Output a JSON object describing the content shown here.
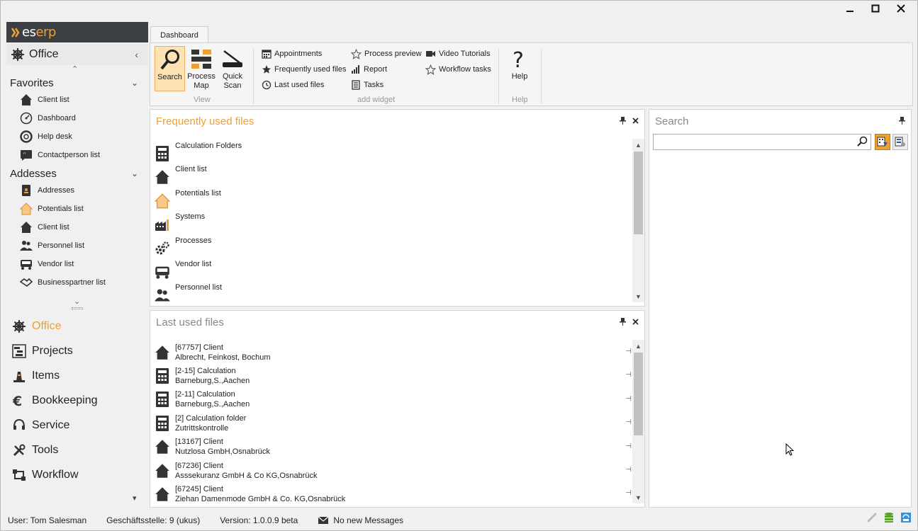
{
  "window": {
    "minimize": "—",
    "maximize": "□",
    "close": "✕"
  },
  "logo": {
    "es": "es",
    "erp": "erp"
  },
  "sidebar": {
    "section_title": "Office",
    "favorites_title": "Favorites",
    "favorites": [
      {
        "label": "Client list",
        "icon": "house-icon"
      },
      {
        "label": "Dashboard",
        "icon": "gauge-icon"
      },
      {
        "label": "Help desk",
        "icon": "lifebuoy-icon"
      },
      {
        "label": "Contactperson list",
        "icon": "quote-icon"
      }
    ],
    "addresses_title": "Addesses",
    "addresses": [
      {
        "label": "Addresses",
        "icon": "addressbook-icon"
      },
      {
        "label": "Potentials list",
        "icon": "house-orange-icon"
      },
      {
        "label": "Client list",
        "icon": "house-icon"
      },
      {
        "label": "Personnel list",
        "icon": "people-icon"
      },
      {
        "label": "Vendor list",
        "icon": "truck-icon"
      },
      {
        "label": "Businesspartner list",
        "icon": "handshake-icon"
      }
    ],
    "modules": [
      {
        "label": "Office",
        "icon": "helm-icon",
        "active": true
      },
      {
        "label": "Projects",
        "icon": "gantt-icon"
      },
      {
        "label": "Items",
        "icon": "items-icon"
      },
      {
        "label": "Bookkeeping",
        "icon": "euro-icon"
      },
      {
        "label": "Service",
        "icon": "headset-icon"
      },
      {
        "label": "Tools",
        "icon": "tools-icon"
      },
      {
        "label": "Workflow",
        "icon": "workflow-icon"
      }
    ]
  },
  "ribbon": {
    "tab": "Dashboard",
    "view": {
      "search": "Search",
      "process_map_1": "Process",
      "process_map_2": "Map",
      "quick_scan_1": "Quick",
      "quick_scan_2": "Scan",
      "label": "View"
    },
    "widgets": {
      "appointments": "Appointments",
      "frequently": "Frequently used files",
      "last_used": "Last used files",
      "process_preview": "Process preview",
      "report": "Report",
      "tasks": "Tasks",
      "video": "Video Tutorials",
      "workflow_tasks": "Workflow tasks",
      "label": "add widget"
    },
    "help": {
      "button": "Help",
      "label": "Help"
    }
  },
  "frequent": {
    "title": "Frequently used files",
    "items": [
      {
        "label": "Calculation Folders",
        "icon": "calculator-icon"
      },
      {
        "label": "Client list",
        "icon": "house-icon"
      },
      {
        "label": "Potentials list",
        "icon": "house-orange-icon"
      },
      {
        "label": "Systems",
        "icon": "factory-icon"
      },
      {
        "label": "Processes",
        "icon": "gears-icon"
      },
      {
        "label": "Vendor list",
        "icon": "truck-icon"
      },
      {
        "label": "Personnel list",
        "icon": "people-icon"
      }
    ]
  },
  "lastused": {
    "title": "Last used files",
    "items": [
      {
        "line1": "[67757] Client",
        "line2": "Albrecht, Feinkost, Bochum",
        "icon": "house-icon"
      },
      {
        "line1": "[2-15] Calculation",
        "line2": "Barneburg,S.,Aachen",
        "icon": "calculator-icon"
      },
      {
        "line1": "[2-11] Calculation",
        "line2": "Barneburg,S.,Aachen",
        "icon": "calculator-icon"
      },
      {
        "line1": "[2] Calculation folder",
        "line2": "Zutrittskontrolle",
        "icon": "calculator-icon"
      },
      {
        "line1": "[13167] Client",
        "line2": "Nutzlosa GmbH,Osnabrück",
        "icon": "house-icon"
      },
      {
        "line1": "[67236] Client",
        "line2": "Asssekuranz GmbH & Co KG,Osnabrück",
        "icon": "house-icon"
      },
      {
        "line1": "[67245] Client",
        "line2": "Ziehan Damenmode GmbH & Co. KG,Osnabrück",
        "icon": "house-icon"
      }
    ]
  },
  "search_panel": {
    "title": "Search",
    "value": ""
  },
  "status": {
    "user": "User: Tom Salesman",
    "office": "Geschäftsstelle: 9 (ukus)",
    "version": "Version: 1.0.0.9 beta",
    "messages": "No new Messages"
  }
}
